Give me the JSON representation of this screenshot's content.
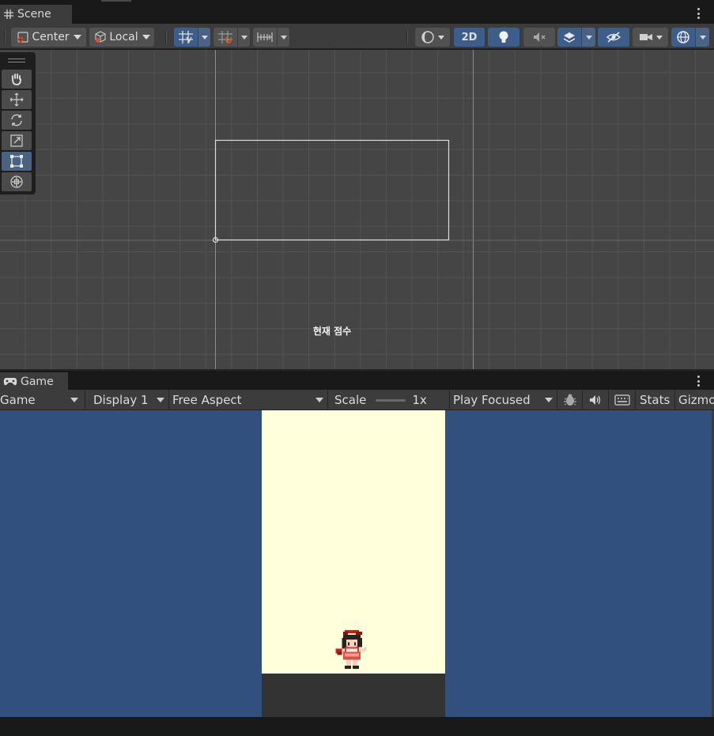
{
  "scene": {
    "tab_label": "Scene",
    "toolbar": {
      "pivot_label": "Center",
      "space_label": "Local",
      "mode_2d_label": "2D"
    },
    "tools": [
      {
        "name": "hand-tool"
      },
      {
        "name": "move-tool"
      },
      {
        "name": "rotate-tool"
      },
      {
        "name": "scale-tool"
      },
      {
        "name": "rect-tool",
        "active": true
      },
      {
        "name": "transform-tool"
      }
    ],
    "world_label": "현재 점수"
  },
  "game": {
    "tab_label": "Game",
    "toolbar": {
      "view_select": "Game",
      "display_select": "Display 1",
      "aspect_select": "Free Aspect",
      "scale_label": "Scale",
      "scale_value": "1x",
      "play_mode_select": "Play Focused",
      "stats_label": "Stats",
      "gizmos_label": "Gizmos"
    }
  },
  "colors": {
    "accent_blue": "#3d5e8a",
    "game_background": "#32507d",
    "game_screen": "#ffffdb",
    "game_floor": "#333333"
  }
}
